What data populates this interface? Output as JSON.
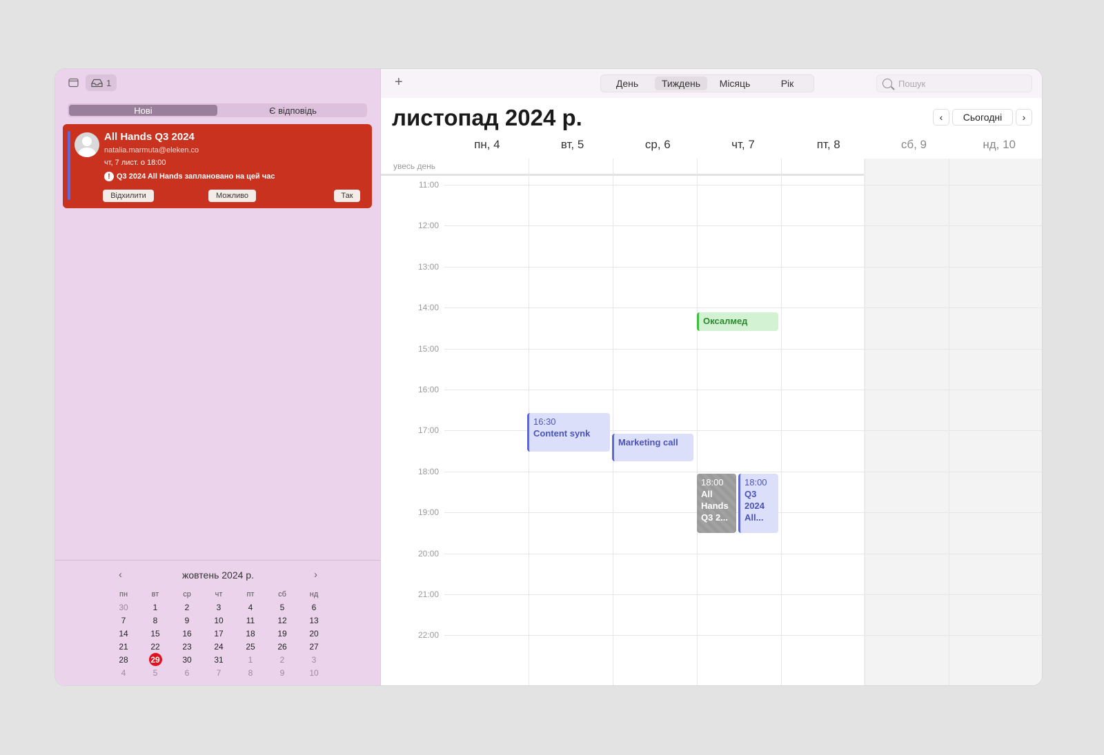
{
  "sidebar": {
    "inbox_count": "1",
    "tabs": [
      {
        "label": "Нові"
      },
      {
        "label": "Є відповідь"
      }
    ],
    "invite": {
      "title": "All Hands Q3 2024",
      "email": "natalia.marmuta@eleken.co",
      "time": "чт, 7 лист. о 18:00",
      "note": "Q3 2024 All Hands заплановано на цей час",
      "decline": "Відхилити",
      "maybe": "Можливо",
      "accept": "Так"
    },
    "mini_calendar": {
      "title": "жовтень 2024 р.",
      "dow": [
        "пн",
        "вт",
        "ср",
        "чт",
        "пт",
        "сб",
        "нд"
      ],
      "weeks": [
        [
          "30",
          "1",
          "2",
          "3",
          "4",
          "5",
          "6"
        ],
        [
          "7",
          "8",
          "9",
          "10",
          "11",
          "12",
          "13"
        ],
        [
          "14",
          "15",
          "16",
          "17",
          "18",
          "19",
          "20"
        ],
        [
          "21",
          "22",
          "23",
          "24",
          "25",
          "26",
          "27"
        ],
        [
          "28",
          "29",
          "30",
          "31",
          "1",
          "2",
          "3"
        ],
        [
          "4",
          "5",
          "6",
          "7",
          "8",
          "9",
          "10"
        ]
      ],
      "today": "29"
    }
  },
  "toolbar": {
    "views": [
      {
        "label": "День"
      },
      {
        "label": "Тиждень"
      },
      {
        "label": "Місяць"
      },
      {
        "label": "Рік"
      }
    ],
    "selected_view": "Тиждень",
    "search_placeholder": "Пошук"
  },
  "main": {
    "title": "листопад 2024 р.",
    "today_label": "Сьогодні",
    "days": [
      "пн, 4",
      "вт, 5",
      "ср, 6",
      "чт, 7",
      "пт, 8",
      "сб, 9",
      "нд, 10"
    ],
    "all_day_label": "увесь день",
    "hours": [
      "11:00",
      "12:00",
      "13:00",
      "14:00",
      "15:00",
      "16:00",
      "17:00",
      "18:00",
      "19:00",
      "20:00",
      "21:00",
      "22:00"
    ],
    "events": [
      {
        "title": "Оксалмед",
        "time": "",
        "color": "#3cc03c"
      },
      {
        "title": "Content synk",
        "time": "16:30",
        "color": "#5e67d6"
      },
      {
        "title": "Marketing call",
        "time": "",
        "color": "#5e67d6"
      },
      {
        "title": "All Hands Q3 2...",
        "time": "18:00",
        "color": "#9a9a9a"
      },
      {
        "title": "Q3 2024 All...",
        "time": "18:00",
        "color": "#5e67d6"
      }
    ]
  },
  "colors": {
    "invite_bg": "#c9321f",
    "sidebar_bg": "#ecd3ec",
    "today_marker": "#e1111e"
  }
}
